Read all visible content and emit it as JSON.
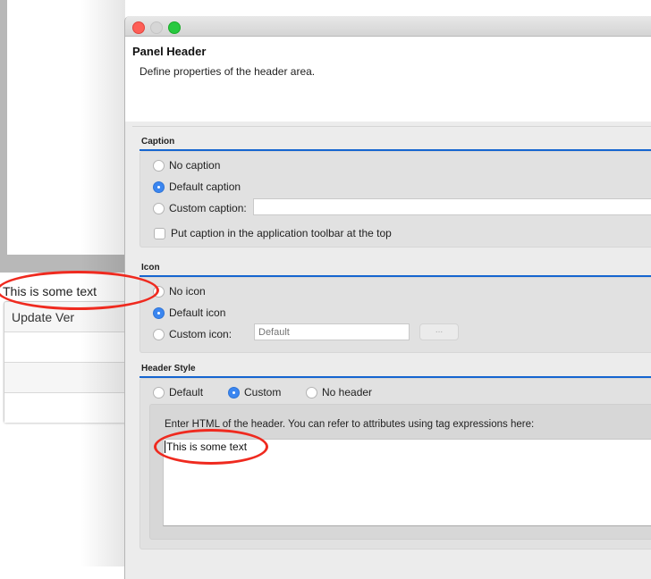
{
  "background_window": {
    "sample_text": "This is some text",
    "table": {
      "header": "Update Ver",
      "rows": [
        "",
        "",
        ""
      ]
    }
  },
  "dialog": {
    "traffic_lights": {
      "close": "close-button",
      "minimize": "minimize-button",
      "zoom": "zoom-button"
    },
    "title": "Panel Header",
    "description": "Define properties of the header area.",
    "sections": {
      "caption": {
        "title": "Caption",
        "options": [
          {
            "label": "No caption",
            "selected": false
          },
          {
            "label": "Default caption",
            "selected": true
          },
          {
            "label": "Custom caption:",
            "selected": false
          }
        ],
        "custom_value": "",
        "toolbar_checkbox": {
          "label": "Put caption in the application toolbar at the top",
          "checked": false
        }
      },
      "icon": {
        "title": "Icon",
        "options": [
          {
            "label": "No icon",
            "selected": false
          },
          {
            "label": "Default icon",
            "selected": true
          },
          {
            "label": "Custom icon:",
            "selected": false
          }
        ],
        "custom_placeholder": "Default",
        "browse_label": "..."
      },
      "header_style": {
        "title": "Header Style",
        "options": [
          {
            "label": "Default",
            "selected": false
          },
          {
            "label": "Custom",
            "selected": true
          },
          {
            "label": "No header",
            "selected": false
          }
        ],
        "html_label": "Enter HTML of the header. You can refer to attributes using tag expressions here:",
        "html_value": "This is some text"
      }
    }
  },
  "colors": {
    "accent": "#1565d0",
    "radio_selected": "#3b86f0",
    "annotation": "#ef2a1f"
  }
}
